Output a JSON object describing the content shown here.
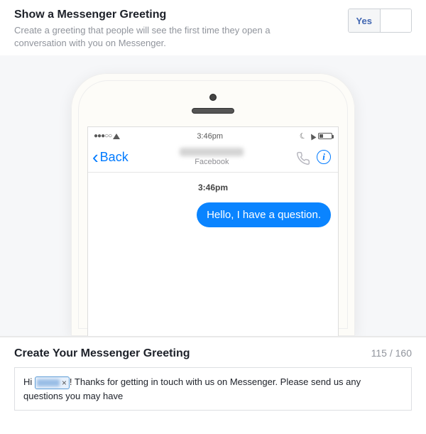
{
  "header": {
    "title": "Show a Messenger Greeting",
    "description": "Create a greeting that people will see the first time they open a conversation with you on Messenger."
  },
  "toggle": {
    "yes_label": "Yes",
    "no_label": "",
    "selected": "yes"
  },
  "phone": {
    "status_time": "3:46pm",
    "back_label": "Back",
    "nav_subtitle": "Facebook",
    "info_glyph": "i",
    "chat_time": "3:46pm",
    "message": "Hello, I have a question."
  },
  "compose": {
    "title": "Create Your Messenger Greeting",
    "count": "115 / 160",
    "prefix": "Hi ",
    "token_remove": "×",
    "suffix": "! Thanks for getting in touch with us on Messenger. Please send us any questions you may have"
  }
}
